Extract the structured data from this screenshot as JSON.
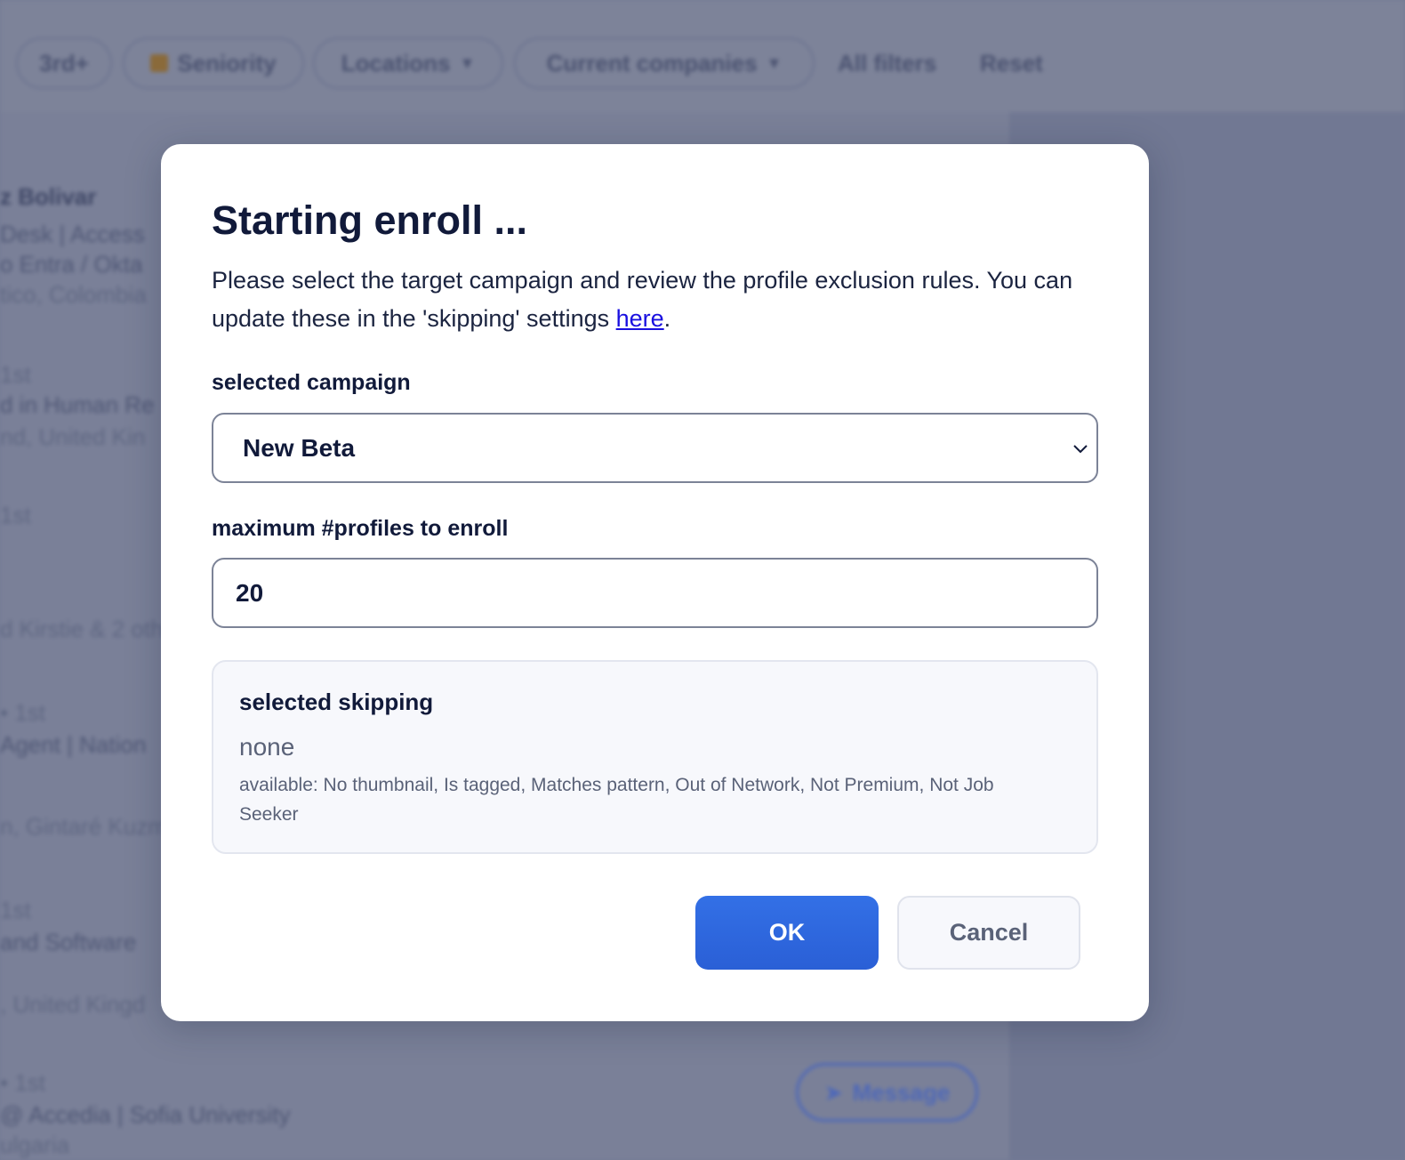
{
  "background": {
    "filters": {
      "pill_3rd": "3rd+",
      "pill_seniority": "Seniority",
      "pill_locations": "Locations",
      "pill_current_companies": "Current companies",
      "all_filters": "All filters",
      "reset": "Reset"
    },
    "rows": {
      "r1_name": "z Bolivar",
      "r1_line2": "Desk | Access",
      "r1_line3": "o Entra / Okta",
      "r1_line4": "tico, Colombia",
      "r2_deg": "1st",
      "r2_title": "d in Human Re",
      "r2_loc": "nd, United Kin",
      "r3_deg": "1st",
      "r3_mutual": "d Kirstie & 2 oth",
      "r4_deg": "• 1st",
      "r4_title": "Agent | Nation",
      "r4_mutual": "n, Gintaré Kuzm",
      "r5_deg": "1st",
      "r5_title": "and Software",
      "r5_loc": ", United Kingd",
      "r6_deg": "• 1st",
      "r6_title": "@ Accedia | Sofia University",
      "r6_loc": "ulgaria"
    },
    "message_button": "Message"
  },
  "modal": {
    "title": "Starting enroll ...",
    "description_pre": "Please select the target campaign and review the profile exclusion rules. You can update these in the 'skipping' settings ",
    "description_link": "here",
    "description_post": ".",
    "campaign_label": "selected campaign",
    "campaign_value": "New Beta",
    "max_label": "maximum #profiles to enroll",
    "max_value": "20",
    "skipping": {
      "title": "selected skipping",
      "value": "none",
      "available": "available: No thumbnail, Is tagged, Matches pattern, Out of Network, Not Premium, Not Job Seeker"
    },
    "ok_label": "OK",
    "cancel_label": "Cancel"
  },
  "colors": {
    "primary": "#2f68e0",
    "link": "#1a10e0",
    "overlay": "#737b94"
  }
}
